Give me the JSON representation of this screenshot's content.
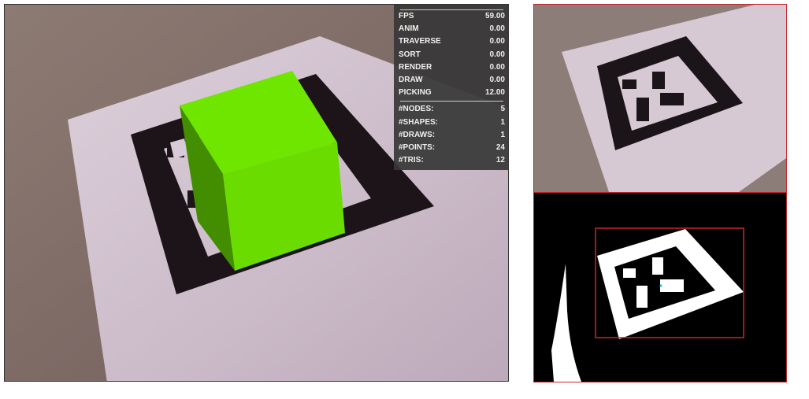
{
  "stats": {
    "timing": [
      {
        "label": "FPS",
        "value": "59.00"
      },
      {
        "label": "ANIM",
        "value": "0.00"
      },
      {
        "label": "TRAVERSE",
        "value": "0.00"
      },
      {
        "label": "SORT",
        "value": "0.00"
      },
      {
        "label": "RENDER",
        "value": "0.00"
      },
      {
        "label": "DRAW",
        "value": "0.00"
      },
      {
        "label": "PICKING",
        "value": "12.00"
      }
    ],
    "counts": [
      {
        "label": "#NODES:",
        "value": "5"
      },
      {
        "label": "#SHAPES:",
        "value": "1"
      },
      {
        "label": "#DRAWS:",
        "value": "1"
      },
      {
        "label": "#POINTS:",
        "value": "24"
      },
      {
        "label": "#TRIS:",
        "value": "12"
      }
    ]
  },
  "colors": {
    "cube_front": "#6bdc00",
    "cube_top": "#6ee600",
    "cube_side": "#3f8a00",
    "marker": "#1c1418",
    "paper": "#cdbcc8",
    "highlight": "#c9262c"
  }
}
